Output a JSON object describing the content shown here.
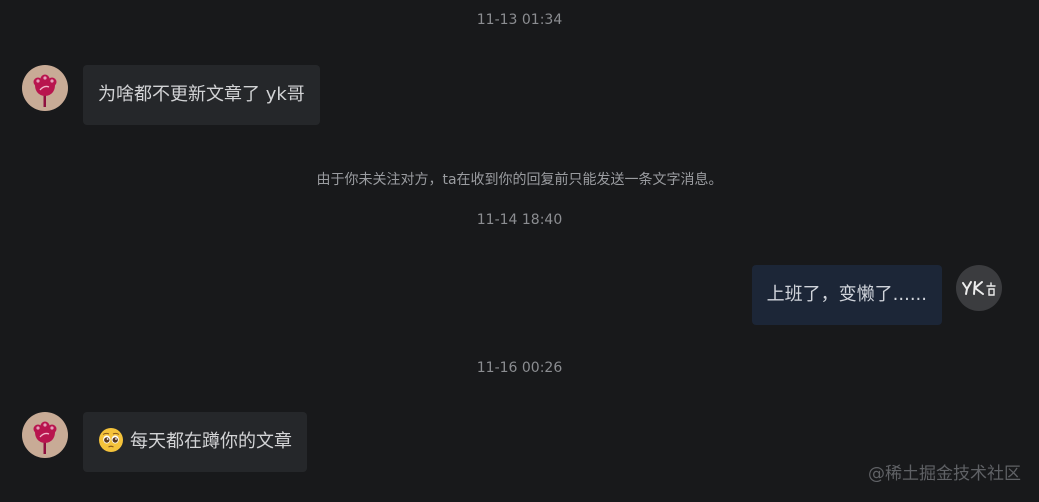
{
  "conversation": {
    "messages": [
      {
        "timestamp": "11-13 01:34",
        "text": "为啥都不更新文章了 yk哥",
        "sender": "other"
      },
      {
        "notice": "由于你未关注对方，ta在收到你的回复前只能发送一条文字消息。"
      },
      {
        "timestamp": "11-14 18:40",
        "text": "上班了，变懒了......",
        "sender": "me"
      },
      {
        "timestamp": "11-16 00:26",
        "text": "每天都在蹲你的文章",
        "sender": "other",
        "emoji": "pleading-face-emoji"
      }
    ]
  },
  "avatars": {
    "other": {
      "icon": "flower-avatar-icon",
      "bg": "#c8ab96",
      "accent": "#b8154e"
    },
    "me": {
      "icon": "yk-handwritten-avatar-icon",
      "bg": "#3b3c3f"
    }
  },
  "colors": {
    "background": "#18191b",
    "incoming_bubble": "#25272a",
    "outgoing_bubble": "#1c2637"
  },
  "watermark": {
    "text": "@稀土掘金技术社区"
  }
}
